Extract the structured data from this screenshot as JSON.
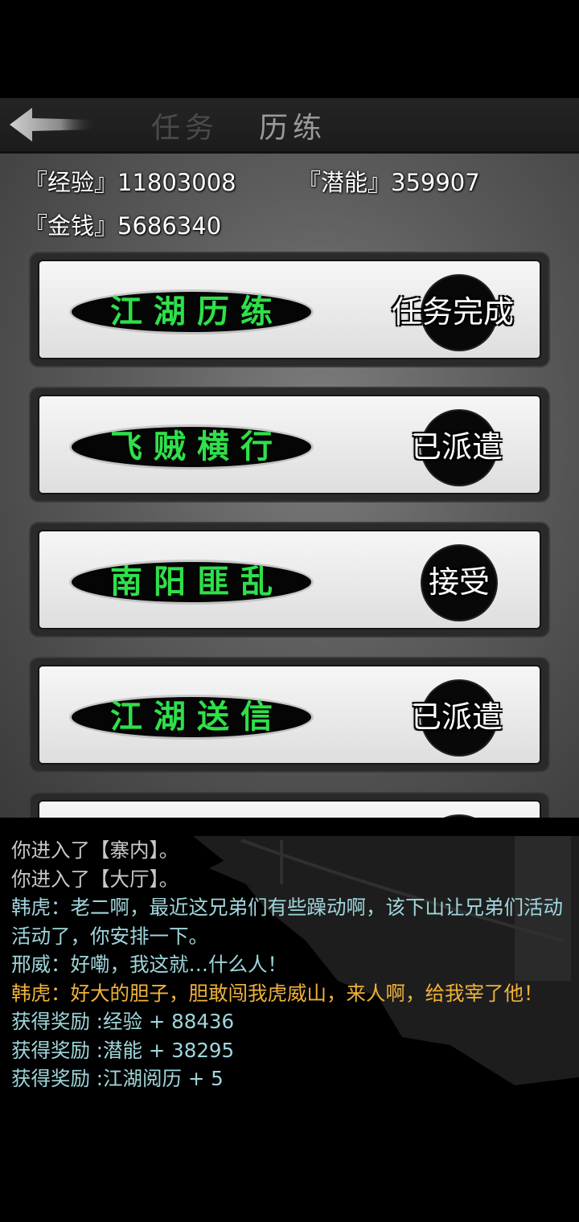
{
  "header": {
    "tab_task": "任务",
    "tab_training": "历练"
  },
  "stats": {
    "exp": "『经验』11803008",
    "potential": "『潜能』359907",
    "money": "『金钱』5686340"
  },
  "quests": [
    {
      "title": "江湖历练",
      "status": "任务完成"
    },
    {
      "title": "飞贼横行",
      "status": "已派遣"
    },
    {
      "title": "南阳匪乱",
      "status": "接受"
    },
    {
      "title": "江湖送信",
      "status": "已派遣"
    }
  ],
  "log": [
    {
      "text": "你进入了【寨内】。",
      "color": "gray"
    },
    {
      "text": "你进入了【大厅】。",
      "color": "gray"
    },
    {
      "text": "韩虎：老二啊，最近这兄弟们有些躁动啊，该下山让兄弟们活动活动了，你安排一下。",
      "color": "cyan"
    },
    {
      "text": "邢威：好嘞，我这就…什么人！",
      "color": "cyan"
    },
    {
      "text": "韩虎：好大的胆子，胆敢闯我虎威山，来人啊，给我宰了他！",
      "color": "gold"
    },
    {
      "text": "获得奖励 :经验 + 88436",
      "color": "cyan"
    },
    {
      "text": "获得奖励 :潜能 + 38295",
      "color": "cyan"
    },
    {
      "text": "获得奖励 :江湖阅历 + 5",
      "color": "cyan"
    }
  ],
  "colors": {
    "quest_title": "#2fe04a",
    "log_gray": "#c8c8c8",
    "log_cyan": "#9fd6dc",
    "log_gold": "#f0b23a"
  },
  "icons": {
    "back": "back-arrow-icon",
    "seal": "ink-circle-seal"
  }
}
